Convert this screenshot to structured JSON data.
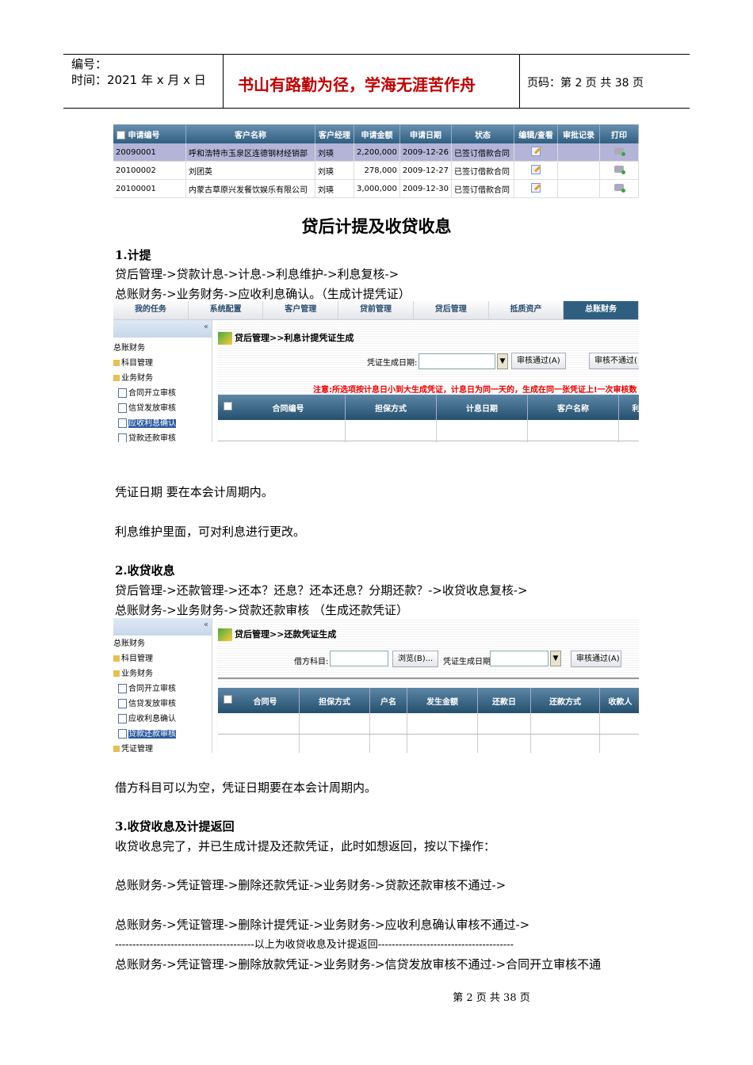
{
  "header": {
    "number_label": "编号：",
    "time_label": "时间：2021 年 x 月 x 日",
    "motto": "书山有路勤为径，学海无涯苦作舟",
    "page_info": "页码：第 2 页  共 38 页"
  },
  "table1": {
    "headers": [
      "申请编号",
      "客户名称",
      "客户经理",
      "申请金额",
      "申请日期",
      "状态",
      "编辑/查看",
      "审批记录",
      "打印"
    ],
    "rows": [
      [
        "20090001",
        "呼和浩特市玉泉区连德钢材经销部",
        "刘瑛",
        "2,200,000",
        "2009-12-26",
        "已签订借款合同"
      ],
      [
        "20100002",
        "刘团英",
        "刘瑛",
        "278,000",
        "2009-12-27",
        "已签订借款合同"
      ],
      [
        "20100001",
        "内蒙古草原兴发餐饮娱乐有限公司",
        "刘瑛",
        "3,000,000",
        "2009-12-30",
        "已签订借款合同"
      ]
    ]
  },
  "section_title": "贷后计提及收贷收息",
  "s1": {
    "heading": "1.计提",
    "line1": "贷后管理->贷款计息->计息->利息维护->利息复核->",
    "line2": "总账财务->业务财务->应收利息确认。（生成计提凭证）",
    "note1": "凭证日期  要在本会计周期内。",
    "note2": "利息维护里面，可对利息进行更改。"
  },
  "shot1": {
    "tabs": [
      "我的任务",
      "系统配置",
      "客户管理",
      "贷前管理",
      "贷后管理",
      "抵质资产",
      "总账财务"
    ],
    "collapse": "«",
    "tree": [
      "总账财务",
      "科目管理",
      "业务财务",
      "合同开立审核",
      "信贷发放审核",
      "应收利息确认",
      "贷款还款审核"
    ],
    "crumb": "贷后管理>>利息计提凭证生成",
    "date_label": "凭证生成日期:",
    "btn_pass": "审核通过(A)",
    "btn_fail": "审核不通过(",
    "warning": "注意:所选项按计息日小到大生成凭证，计息日为同一天的，生成在同一张凭证上!一次审核数",
    "cols": [
      "合同编号",
      "担保方式",
      "计息日期",
      "客户名称",
      "利息"
    ]
  },
  "s2": {
    "heading": "2.收贷收息",
    "line1": "贷后管理->还款管理->还本？还息？还本还息？分期还款？->收贷收息复核->",
    "line2": "总账财务->业务财务->贷款还款审核    （生成还款凭证）",
    "note": "借方科目可以为空，凭证日期要在本会计周期内。"
  },
  "shot2": {
    "collapse": "«",
    "tree": [
      "总账财务",
      "科目管理",
      "业务财务",
      "合同开立审核",
      "信贷发放审核",
      "应收利息确认",
      "贷款还款审核",
      "凭证管理"
    ],
    "crumb": "贷后管理>>还款凭证生成",
    "debit_label": "借方科目:",
    "browse": "浏览(B)...",
    "date_label": "凭证生成日期:",
    "btn_pass": "审核通过(A)",
    "cols": [
      "合同号",
      "担保方式",
      "户名",
      "发生金额",
      "还款日",
      "还款方式",
      "收款人"
    ]
  },
  "s3": {
    "heading": "3.收贷收息及计提返回",
    "line1": "收贷收息完了，并已生成计提及还款凭证，此时如想返回，按以下操作：",
    "line2": "总账财务->凭证管理->删除还款凭证->业务财务->贷款还款审核不通过->",
    "line3": "总账财务->凭证管理->删除计提凭证->业务财务->应收利息确认审核不通过->",
    "line4": "----------------------------------------以上为收贷收息及计提返回---------------------------------------",
    "line5": "总账财务->凭证管理->删除放款凭证->业务财务->信贷发放审核不通过->合同开立审核不通"
  },
  "footer": "第  2  页  共  38  页"
}
